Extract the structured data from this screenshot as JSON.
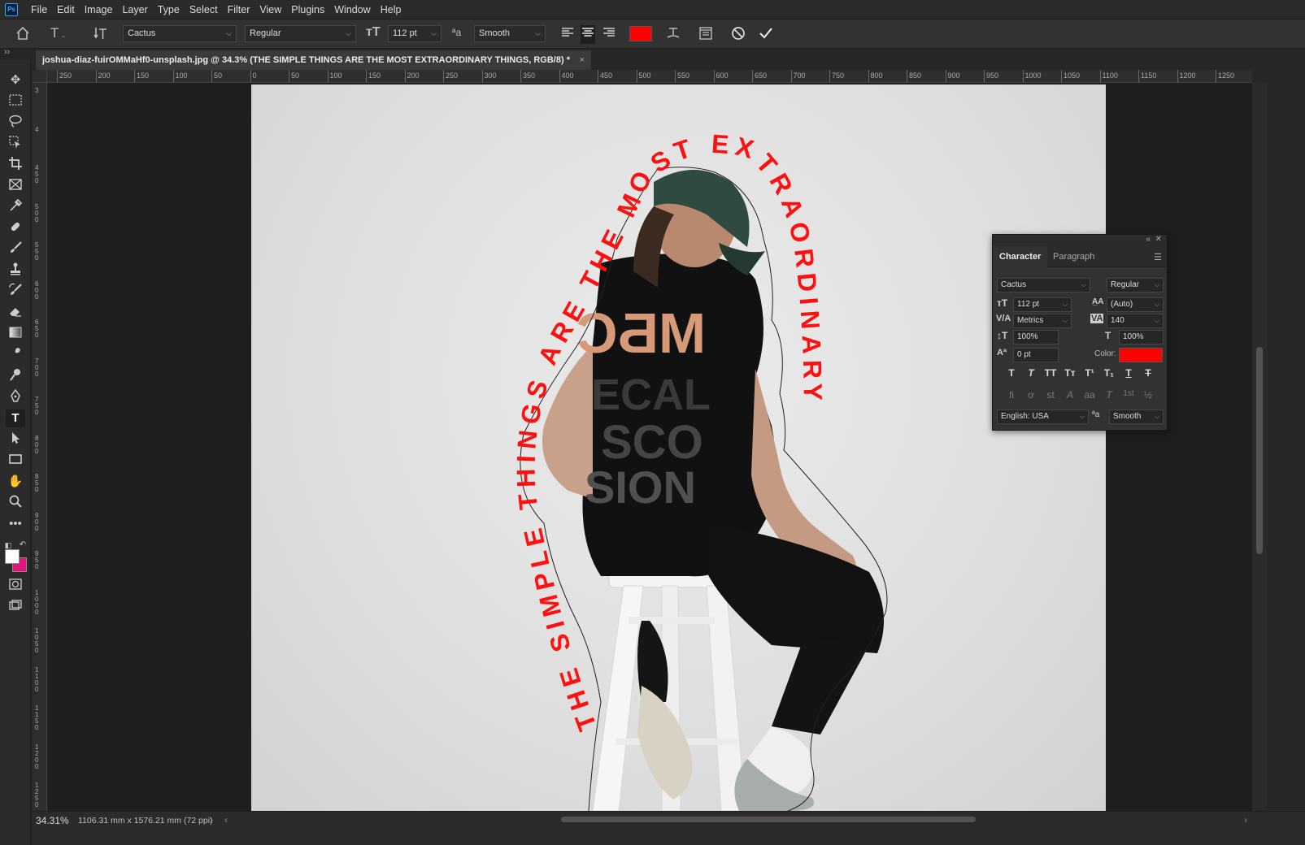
{
  "menubar": {
    "logo": "Ps",
    "items": [
      "File",
      "Edit",
      "Image",
      "Layer",
      "Type",
      "Select",
      "Filter",
      "View",
      "Plugins",
      "Window",
      "Help"
    ]
  },
  "options": {
    "font_family": "Cactus",
    "font_style": "Regular",
    "font_size": "112 pt",
    "antialias": "Smooth",
    "text_color": "#ff0000"
  },
  "document": {
    "tab_title": "joshua-diaz-fuirOMMaHf0-unsplash.jpg @ 34.3% (THE SIMPLE THINGS ARE THE MOST EXTRAORDINARY THINGS, RGB/8) *",
    "close": "×",
    "path_text": "THE SIMPLE THINGS ARE THE MOST EXTRAORDINARY THINGS",
    "path_text_color": "#ff1010",
    "shirt_text_1": "ECAL",
    "shirt_text_2": "SCO",
    "shirt_text_3": "SION"
  },
  "ruler": {
    "h_labels": [
      "250",
      "200",
      "150",
      "100",
      "50",
      "0",
      "50",
      "100",
      "150",
      "200",
      "250",
      "300",
      "350",
      "400",
      "450",
      "500",
      "550",
      "600",
      "650",
      "700",
      "750",
      "800",
      "850",
      "900",
      "950",
      "1000",
      "1050",
      "1100",
      "1150",
      "1200",
      "1250"
    ],
    "v_labels": [
      "3",
      "4",
      "4 5 0",
      "5 0 0",
      "5 5 0",
      "6 0 0",
      "6 5 0",
      "7 0 0",
      "7 5 0",
      "8 0 0",
      "8 5 0",
      "9 0 0",
      "9 5 0",
      "1 0 0 0",
      "1 0 5 0",
      "1 1 0 0",
      "1 1 5 0",
      "1 2 0 0",
      "1 2 5 0"
    ]
  },
  "status": {
    "zoom": "34.31%",
    "doc_size": "1106.31 mm x 1576.21 mm (72 ppi)"
  },
  "character_panel": {
    "tab_character": "Character",
    "tab_paragraph": "Paragraph",
    "font_family": "Cactus",
    "font_style": "Regular",
    "font_size": "112 pt",
    "leading": "(Auto)",
    "kerning": "Metrics",
    "tracking": "140",
    "vertical_scale": "100%",
    "horizontal_scale": "100%",
    "baseline_shift": "0 pt",
    "color_label": "Color:",
    "color": "#ff0000",
    "language": "English: USA",
    "antialias": "Smooth",
    "style_buttons": [
      "T",
      "T",
      "TT",
      "Tт",
      "T¹",
      "T₁",
      "T",
      "T"
    ],
    "opentype_buttons": [
      "fi",
      "ơ",
      "st",
      "A",
      "aa",
      "T",
      "1st",
      "½"
    ]
  }
}
